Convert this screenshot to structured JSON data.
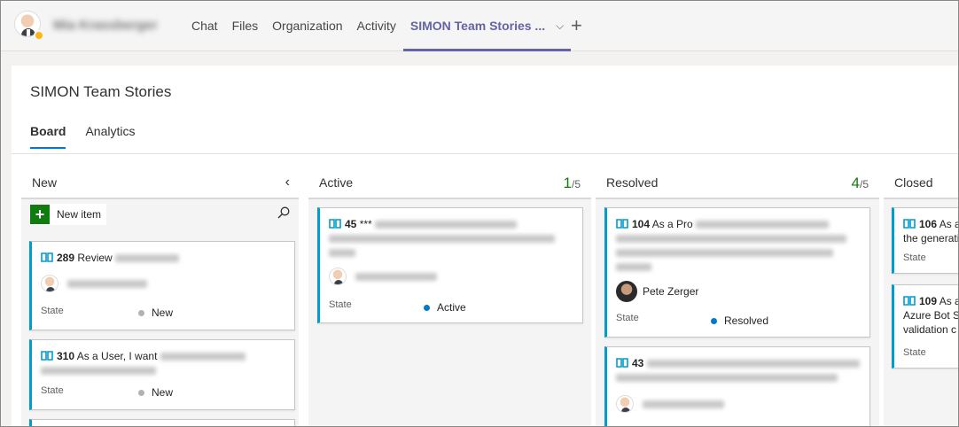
{
  "app": {
    "user_name": "Mia Krassberger",
    "nav_tabs": [
      "Chat",
      "Files",
      "Organization",
      "Activity"
    ],
    "active_tab": "SIMON Team Stories ...",
    "add_tab": "+"
  },
  "page": {
    "title": "SIMON Team Stories",
    "tabs": [
      "Board",
      "Analytics"
    ]
  },
  "board": {
    "columns": {
      "new": {
        "title": "New",
        "new_item_label": "New item"
      },
      "active": {
        "title": "Active",
        "count": "1",
        "limit": "/5"
      },
      "resolved": {
        "title": "Resolved",
        "count": "4",
        "limit": "/5"
      },
      "closed": {
        "title": "Closed"
      }
    },
    "state_label": "State",
    "cards": {
      "c289": {
        "id": "289",
        "title": "Review",
        "state": "New"
      },
      "c310": {
        "id": "310",
        "title": "As a User, I want",
        "state": "New"
      },
      "c45": {
        "id": "45",
        "title": "***",
        "state": "Active"
      },
      "c104": {
        "id": "104",
        "title": "As a Pro",
        "assignee": "Pete Zerger",
        "state": "Resolved"
      },
      "c43": {
        "id": "43",
        "title": ""
      },
      "c106": {
        "id": "106",
        "title": "As a",
        "title2": "the generati"
      },
      "c109": {
        "id": "109",
        "title": "As a",
        "title2": "Azure Bot S",
        "title3": "validation c"
      }
    }
  },
  "colors": {
    "accent": "#6264a7",
    "card_border": "#009ccc",
    "new_state": "#b2b2b2",
    "active_state": "#007acc",
    "count_green": "#107c10"
  }
}
